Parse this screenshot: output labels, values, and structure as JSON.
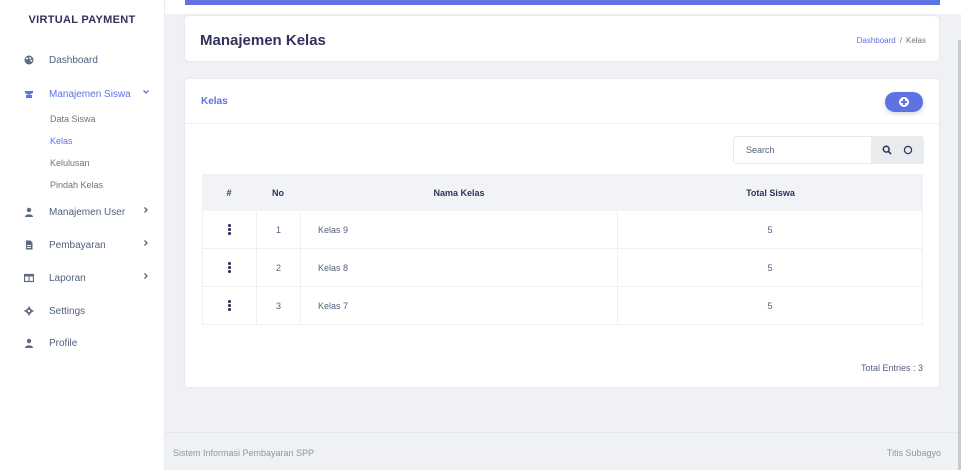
{
  "sidebar": {
    "brand": "VIRTUAL PAYMENT",
    "items": [
      {
        "label": "Dashboard",
        "icon": "palette-icon"
      },
      {
        "label": "Manajemen Siswa",
        "icon": "graduation-icon",
        "chevron": "chevron-down-icon"
      },
      {
        "label": "Manajemen User",
        "icon": "user-icon",
        "chevron": "chevron-right-icon"
      },
      {
        "label": "Pembayaran",
        "icon": "receipt-icon",
        "chevron": "chevron-right-icon"
      },
      {
        "label": "Laporan",
        "icon": "table-icon",
        "chevron": "chevron-right-icon"
      },
      {
        "label": "Settings",
        "icon": "gear-icon"
      },
      {
        "label": "Profile",
        "icon": "user-icon"
      }
    ],
    "subitems": [
      "Data Siswa",
      "Kelas",
      "Kelulusan",
      "Pindah Kelas"
    ]
  },
  "header": {
    "title": "Manajemen Kelas",
    "breadcrumb_home": "Dashboard",
    "breadcrumb_sep": "/",
    "breadcrumb_current": "Kelas"
  },
  "card": {
    "title": "Kelas",
    "search_placeholder": "Search",
    "columns": [
      "#",
      "No",
      "Nama Kelas",
      "Total Siswa"
    ],
    "rows": [
      {
        "no": "1",
        "nama": "Kelas 9",
        "total": "5"
      },
      {
        "no": "2",
        "nama": "Kelas 8",
        "total": "5"
      },
      {
        "no": "3",
        "nama": "Kelas 7",
        "total": "5"
      }
    ],
    "total_entries": "Total Entries : 3"
  },
  "footer": {
    "left": "Sistem Informasi Pembayaran SPP",
    "right": "Titis Subagyo"
  },
  "colors": {
    "accent": "#5e72e4",
    "text": "#525f7f",
    "heading": "#32325d"
  }
}
